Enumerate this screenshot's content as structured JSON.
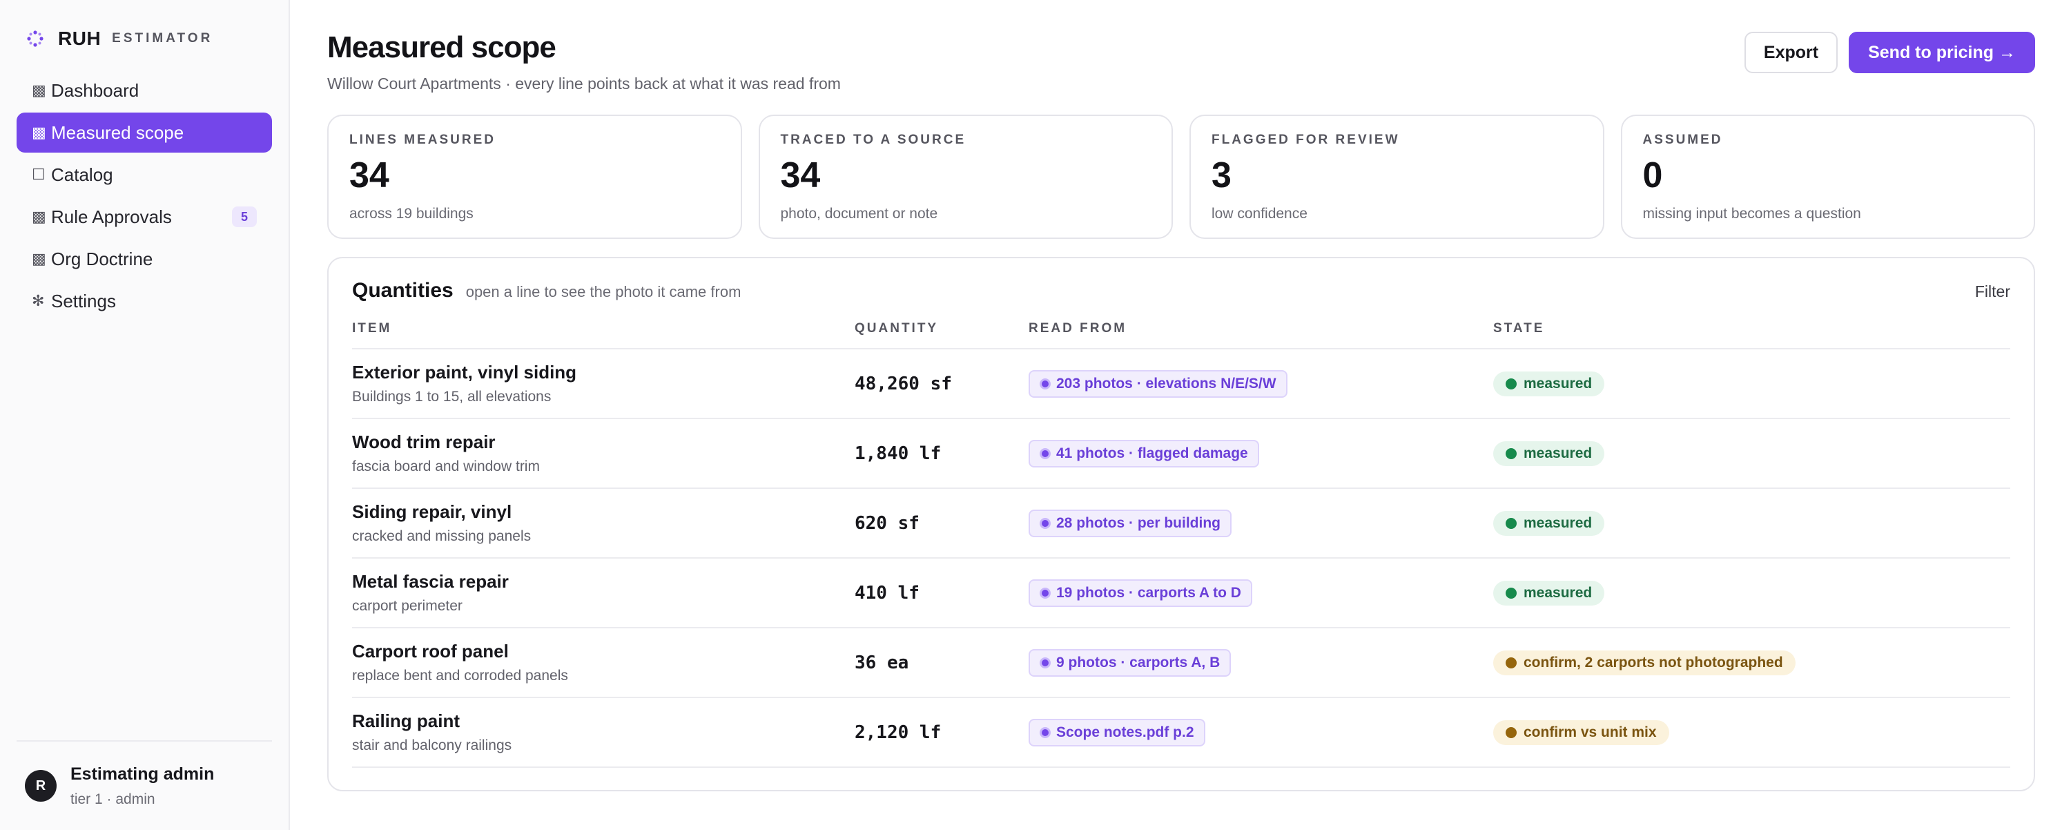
{
  "brand": {
    "name": "RUH",
    "sub": "ESTIMATOR",
    "accent": "#7446ea"
  },
  "sidebar": {
    "items": [
      {
        "label": "Dashboard",
        "icon": "square-filled-icon",
        "glyph": "▩",
        "active": false
      },
      {
        "label": "Measured scope",
        "icon": "square-filled-icon",
        "glyph": "▩",
        "active": true
      },
      {
        "label": "Catalog",
        "icon": "square-outline-icon",
        "glyph": "☐",
        "active": false
      },
      {
        "label": "Rule Approvals",
        "icon": "square-filled-icon",
        "glyph": "▩",
        "active": false,
        "badge": "5"
      },
      {
        "label": "Org Doctrine",
        "icon": "square-filled-icon",
        "glyph": "▩",
        "active": false
      },
      {
        "label": "Settings",
        "icon": "gear-icon",
        "glyph": "✻",
        "active": false
      }
    ]
  },
  "user": {
    "initial": "R",
    "name": "Estimating admin",
    "role": "tier 1 · admin"
  },
  "header": {
    "title": "Measured scope",
    "subtitle": "Willow Court Apartments · every line points back at what it was read from",
    "export_label": "Export",
    "pricing_label": "Send to pricing →"
  },
  "stats": [
    {
      "label": "LINES MEASURED",
      "value": "34",
      "note": "across 19 buildings"
    },
    {
      "label": "TRACED TO A SOURCE",
      "value": "34",
      "note": "photo, document or note"
    },
    {
      "label": "FLAGGED FOR REVIEW",
      "value": "3",
      "note": "low confidence"
    },
    {
      "label": "ASSUMED",
      "value": "0",
      "note": "missing input becomes a question"
    }
  ],
  "quantities": {
    "title": "Quantities",
    "hint": "open a line to see the photo it came from",
    "filter_label": "Filter",
    "columns": {
      "item": "ITEM",
      "quantity": "QUANTITY",
      "read_from": "READ FROM",
      "state": "STATE"
    },
    "rows": [
      {
        "name": "Exterior paint, vinyl siding",
        "desc": "Buildings 1 to 15, all elevations",
        "qty": "48,260 sf",
        "source": "203 photos · elevations N/E/S/W",
        "state": "measured",
        "state_kind": "measured"
      },
      {
        "name": "Wood trim repair",
        "desc": "fascia board and window trim",
        "qty": "1,840 lf",
        "source": "41 photos · flagged damage",
        "state": "measured",
        "state_kind": "measured"
      },
      {
        "name": "Siding repair, vinyl",
        "desc": "cracked and missing panels",
        "qty": "620 sf",
        "source": "28 photos · per building",
        "state": "measured",
        "state_kind": "measured"
      },
      {
        "name": "Metal fascia repair",
        "desc": "carport perimeter",
        "qty": "410 lf",
        "source": "19 photos · carports A to D",
        "state": "measured",
        "state_kind": "measured"
      },
      {
        "name": "Carport roof panel",
        "desc": "replace bent and corroded panels",
        "qty": "36 ea",
        "source": "9 photos · carports A, B",
        "state": "confirm, 2 carports not photographed",
        "state_kind": "confirm"
      },
      {
        "name": "Railing paint",
        "desc": "stair and balcony railings",
        "qty": "2,120 lf",
        "source": "Scope notes.pdf p.2",
        "state": "confirm vs unit mix",
        "state_kind": "confirm"
      }
    ]
  }
}
